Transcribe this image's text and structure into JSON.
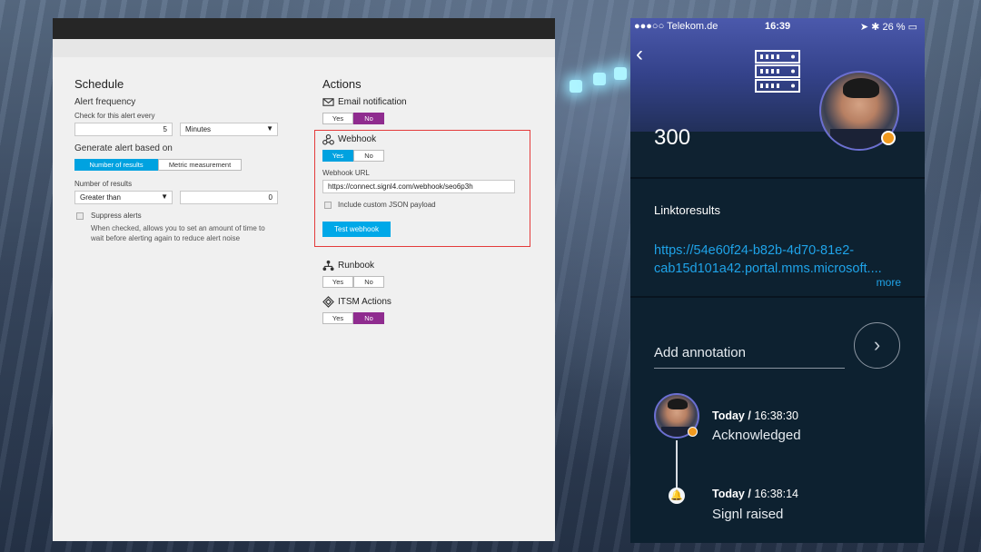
{
  "left": {
    "schedule": {
      "title": "Schedule",
      "alert_frequency": "Alert frequency",
      "check_every": "Check for this alert every",
      "freq_value": "5",
      "freq_unit": "Minutes",
      "generate_based_on": "Generate alert based on",
      "tabs": [
        "Number of results",
        "Metric measurement"
      ],
      "number_of_results": "Number of results",
      "operator": "Greater than",
      "threshold": "0",
      "suppress": "Suppress alerts",
      "suppress_desc_1": "When checked, allows you to set an amount of time to",
      "suppress_desc_2": "wait before alerting again to reduce alert noise"
    },
    "actions": {
      "title": "Actions",
      "email": "Email notification",
      "webhook": "Webhook",
      "webhook_url_label": "Webhook URL",
      "webhook_url": "https://connect.signl4.com/webhook/seo6p3h",
      "custom_json": "Include custom JSON payload",
      "test_webhook": "Test webhook",
      "runbook": "Runbook",
      "itsm": "ITSM Actions",
      "yes": "Yes",
      "no": "No"
    }
  },
  "phone": {
    "carrier": "●●●○○ Telekom.de",
    "time": "16:39",
    "battery": "26 %",
    "count": "300",
    "link_title": "Linktoresults",
    "link_url_1": "https://54e60f24-b82b-4d70-81e2-",
    "link_url_2": "cab15d101a42.portal.mms.microsoft....",
    "more": "more",
    "annotation_placeholder": "Add annotation",
    "timeline": [
      {
        "day": "Today /",
        "time": "16:38:30",
        "text": "Acknowledged"
      },
      {
        "day": "Today /",
        "time": "16:38:14",
        "text": "Signl raised"
      }
    ]
  },
  "colors": {
    "accent_blue": "#00a2e0",
    "toggle_purple": "#8f2c8f",
    "link_blue": "#1fa3e8",
    "highlight_red": "#e43b3b"
  }
}
